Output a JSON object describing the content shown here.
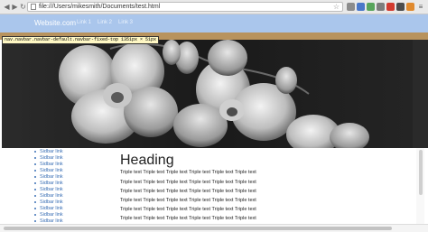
{
  "browser": {
    "url": "file:///Users/mikesmith/Documents/test.html",
    "extensions": [
      {
        "name": "ext-grey-icon",
        "color": "#8c8c8c"
      },
      {
        "name": "ext-blue-icon",
        "color": "#4a78c9"
      },
      {
        "name": "ext-green-icon",
        "color": "#58a55c"
      },
      {
        "name": "ext-globe-icon",
        "color": "#7d7d7d"
      },
      {
        "name": "ext-red-icon",
        "color": "#d23b2f"
      },
      {
        "name": "ext-dark-icon",
        "color": "#4c4c4c"
      },
      {
        "name": "ext-orange-icon",
        "color": "#e08a2e"
      },
      {
        "name": "ext-purple-icon",
        "color": "#8c63c2"
      }
    ]
  },
  "navbar": {
    "brand": "Website.com",
    "links": [
      "Link 1",
      "Link 2",
      "Link 3"
    ]
  },
  "debug_label": "nav.navbar.navbar-default.navbar-fixed-top 1351px × 51px",
  "sidebar": {
    "items": [
      "Sidbar link",
      "Sidbar link",
      "Sidbar link",
      "Sidbar link",
      "Sidbar link",
      "Sidbar link",
      "Sidbar link",
      "Sidbar link",
      "Sidbar link",
      "Sidbar link",
      "Sidbar link",
      "Sidbar link"
    ]
  },
  "main": {
    "heading": "Heading",
    "paragraphs": [
      "Triple text Triple text Triple text Triple text Triple text Triple text",
      "Triple text Triple text Triple text Triple text Triple text Triple text",
      "Triple text Triple text Triple text Triple text Triple text Triple text",
      "Triple text Triple text Triple text Triple text Triple text Triple text",
      "Triple text Triple text Triple text Triple text Triple text Triple text",
      "Triple text Triple text Triple text Triple text Triple text Triple text",
      "Triple text Triple text Triple text Triple text Triple text Triple text"
    ]
  },
  "colors": {
    "navbar_bg": "#aac6ec",
    "link": "#3a6fb5",
    "hero_bg": "#1f1f1f"
  }
}
